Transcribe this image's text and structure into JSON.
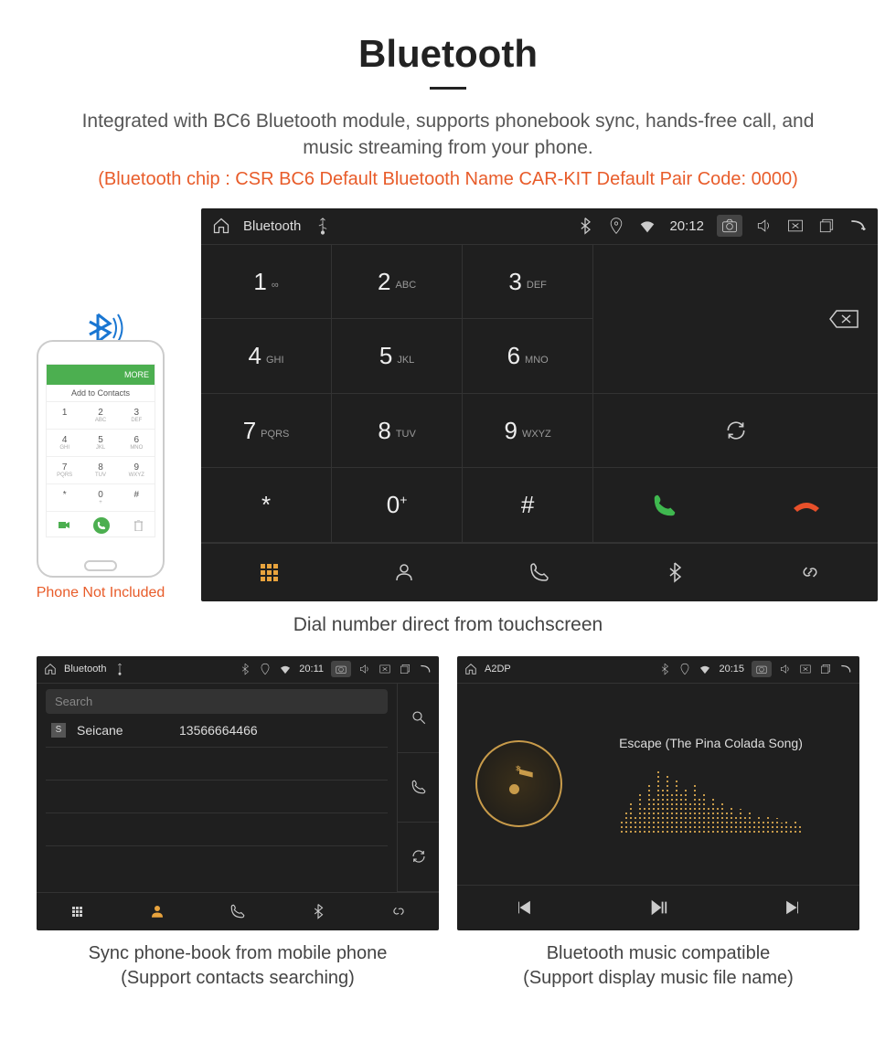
{
  "header": {
    "title": "Bluetooth",
    "description": "Integrated with BC6 Bluetooth module, supports phonebook sync, hands-free call, and music streaming from your phone.",
    "spec": "(Bluetooth chip : CSR BC6    Default Bluetooth Name CAR-KIT    Default Pair Code: 0000)"
  },
  "phone": {
    "not_included": "Phone Not Included",
    "add_contacts": "Add to Contacts",
    "more": "MORE",
    "keys": [
      {
        "n": "1",
        "s": ""
      },
      {
        "n": "2",
        "s": "ABC"
      },
      {
        "n": "3",
        "s": "DEF"
      },
      {
        "n": "4",
        "s": "GHI"
      },
      {
        "n": "5",
        "s": "JKL"
      },
      {
        "n": "6",
        "s": "MNO"
      },
      {
        "n": "7",
        "s": "PQRS"
      },
      {
        "n": "8",
        "s": "TUV"
      },
      {
        "n": "9",
        "s": "WXYZ"
      },
      {
        "n": "*",
        "s": ""
      },
      {
        "n": "0",
        "s": "+"
      },
      {
        "n": "#",
        "s": ""
      }
    ]
  },
  "main_device": {
    "app": "Bluetooth",
    "time": "20:12",
    "keypad": [
      {
        "n": "1",
        "s": "∞"
      },
      {
        "n": "2",
        "s": "ABC"
      },
      {
        "n": "3",
        "s": "DEF"
      },
      {
        "n": "4",
        "s": "GHI"
      },
      {
        "n": "5",
        "s": "JKL"
      },
      {
        "n": "6",
        "s": "MNO"
      },
      {
        "n": "7",
        "s": "PQRS"
      },
      {
        "n": "8",
        "s": "TUV"
      },
      {
        "n": "9",
        "s": "WXYZ"
      },
      {
        "n": "*",
        "s": ""
      },
      {
        "n": "0",
        "s": "+",
        "sup": true
      },
      {
        "n": "#",
        "s": ""
      }
    ],
    "caption": "Dial number direct from touchscreen"
  },
  "contacts_device": {
    "app": "Bluetooth",
    "time": "20:11",
    "search_placeholder": "Search",
    "contact": {
      "badge": "S",
      "name": "Seicane",
      "number": "13566664466"
    },
    "caption_line1": "Sync phone-book from mobile phone",
    "caption_line2": "(Support contacts searching)"
  },
  "music_device": {
    "app": "A2DP",
    "time": "20:15",
    "track": "Escape (The Pina Colada Song)",
    "caption_line1": "Bluetooth music compatible",
    "caption_line2": "(Support display music file name)"
  }
}
